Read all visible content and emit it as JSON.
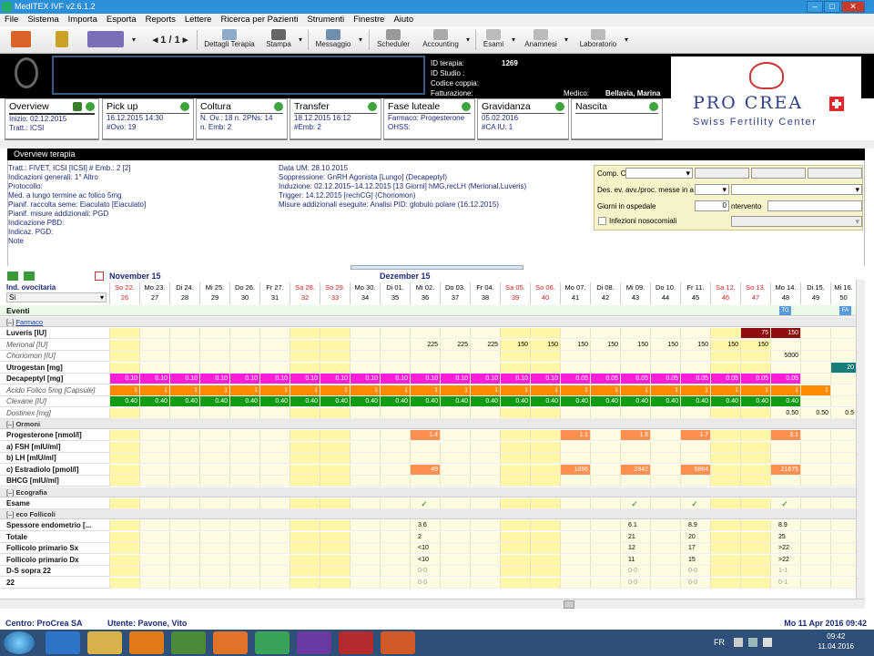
{
  "window": {
    "title": "MedITEX IVF v2.6.1.2",
    "min": "–",
    "max": "□",
    "close": "✕"
  },
  "menu": [
    "File",
    "Sistema",
    "Importa",
    "Esporta",
    "Reports",
    "Lettere",
    "Ricerca per Pazienti",
    "Strumenti",
    "Finestre",
    "Aiuto"
  ],
  "toolbar": {
    "pager": "1 / 1",
    "buttons": [
      "Dettagli Terapia",
      "Stampa",
      "Messaggio",
      "Scheduler",
      "Accounting",
      "Esami",
      "Anamnesi",
      "Laboratorio"
    ]
  },
  "header": {
    "id_terapia_label": "ID terapia:",
    "id_terapia_value": "1269",
    "id_studio_label": "ID Studio :",
    "codice_label": "Codice coppia:",
    "fatt_label": "Fatturazione:",
    "medico_label": "Medico:",
    "medico_value": "Bellavia, Marina"
  },
  "logo": {
    "big": "PRO CREA",
    "small": "Swiss Fertility Center"
  },
  "tabs": [
    {
      "title": "Overview",
      "lines": [
        "Inizio: 02.12.2015",
        "Tratt.: ICSI"
      ]
    },
    {
      "title": "Pick up",
      "lines": [
        "16.12.2015 14:30",
        "#Ovo: 19"
      ]
    },
    {
      "title": "Coltura",
      "lines": [
        "N. Ov.: 18 n. 2PNs: 14",
        "n. Emb: 2"
      ]
    },
    {
      "title": "Transfer",
      "lines": [
        "18.12.2015 16:12",
        "#Emb: 2"
      ]
    },
    {
      "title": "Fase luteale",
      "lines": [
        "Farmaco: Progesterone",
        "OHSS:"
      ]
    },
    {
      "title": "Gravidanza",
      "lines": [
        "05.02.2016",
        "#CA IU: 1"
      ]
    },
    {
      "title": "Nascita",
      "lines": [
        "",
        ""
      ]
    }
  ],
  "overview": {
    "bar": "Overview terapia",
    "left": [
      "Tratt.: FIVET, ICSI    [ICSI]    # Emb.: 2    [2]",
      "Indicazioni generali: 1° Altro",
      "Protocollo:",
      "Med. a lungo termine  ac folico 5mg",
      "Pianif. raccolta seme: Eiaculato    [Eiaculato]",
      "Pianif. misure addizionali: PGD",
      "Indicazione PBD:",
      "Indicaz. PGD:",
      "Note"
    ],
    "mid": [
      "Data UM: 28.10.2015",
      "Soppressione: GnRH Agonista [Lungo] (Decapeptyl)",
      "Induzione: 02.12.2015–14.12.2015 [13 Giorni] hMG,recLH (Merional,Luveris)",
      "Trigger: 14.12.2015 [rechCG] (Choriomon)",
      "Misure addizionali eseguite: Analisi PID: globulo polare (16.12.2015)"
    ],
    "right": {
      "comp": "Comp. C",
      "des": "Des. ev. avv./proc. messe in a",
      "giorni": "Giorni in ospedale",
      "giorni_val": "0",
      "intervento": "ntervento",
      "infezioni": "Infezioni nosocomiali"
    }
  },
  "grid": {
    "months": [
      "November 15",
      "Dezember 15"
    ],
    "ind_label": "Ind. ovocitaria",
    "ind_value": "Si",
    "eventi": "Eventi",
    "dates": [
      {
        "d": "So 22.",
        "n": "26",
        "red": true
      },
      {
        "d": "Mo 23.",
        "n": "27"
      },
      {
        "d": "Di 24.",
        "n": "28"
      },
      {
        "d": "Mi 25.",
        "n": "29"
      },
      {
        "d": "Do 26.",
        "n": "30"
      },
      {
        "d": "Fr 27.",
        "n": "31"
      },
      {
        "d": "Sa 28.",
        "n": "32",
        "red": true
      },
      {
        "d": "So 29.",
        "n": "33",
        "red": true
      },
      {
        "d": "Mo 30.",
        "n": "34"
      },
      {
        "d": "Di 01.",
        "n": "35"
      },
      {
        "d": "Mi 02.",
        "n": "36"
      },
      {
        "d": "Do 03.",
        "n": "37"
      },
      {
        "d": "Fr 04.",
        "n": "38"
      },
      {
        "d": "Sa 05.",
        "n": "39",
        "red": true
      },
      {
        "d": "So 06.",
        "n": "40",
        "red": true
      },
      {
        "d": "Mo 07.",
        "n": "41"
      },
      {
        "d": "Di 08.",
        "n": "42"
      },
      {
        "d": "Mi 09.",
        "n": "43"
      },
      {
        "d": "Do 10.",
        "n": "44"
      },
      {
        "d": "Fr 11.",
        "n": "45"
      },
      {
        "d": "Sa 12.",
        "n": "46",
        "red": true
      },
      {
        "d": "So 13.",
        "n": "47",
        "red": true
      },
      {
        "d": "Mo 14.",
        "n": "48"
      },
      {
        "d": "Di 15.",
        "n": "49"
      },
      {
        "d": "Mi 16.",
        "n": "50"
      }
    ],
    "sections": {
      "farmaco": "Farmaco",
      "ormoni": "Ormoni",
      "ecografia": "Ecografia",
      "follicoli": "eco Follicoli"
    },
    "rows": {
      "luveris": "Luveris [IU]",
      "merional": "Merional [IU]",
      "choriomon": "Choriomon [IU]",
      "utrogestan": "Utrogestan [mg]",
      "decapeptyl": "Decapeptyl [mg]",
      "acido": "Acido Folico 5mg [Capsule]",
      "clexane": "Clexane [IU]",
      "dostinex": "Dostinex [mg]",
      "progesterone": "Progesterone  [nmol/l]",
      "fsh": "a) FSH  [mIU/ml]",
      "lh": "b) LH  [mIU/ml]",
      "estradiolo": "c) Estradiolo  [pmol/l]",
      "bhcg": "BHCG  [mIU/ml]",
      "esame": "Esame",
      "spessore": "Spessore endometrio [...",
      "totale": "Totale",
      "fsx": "Follicolo primario Sx",
      "fdx": "Follicolo primario Dx",
      "ds": "D-S sopra 22",
      "n22": "22"
    },
    "values": {
      "luveris": {
        "21": "75",
        "22": "150"
      },
      "merional": {
        "10": "225",
        "11": "225",
        "12": "225",
        "13": "150",
        "14": "150",
        "15": "150",
        "16": "150",
        "17": "150",
        "18": "150",
        "19": "150",
        "20": "150",
        "21": "150"
      },
      "choriomon": {
        "22": "5000"
      },
      "utrogestan": {
        "24": "20"
      },
      "decapeptyl": {
        "0": "0.10",
        "1": "0.10",
        "2": "0.10",
        "3": "0.10",
        "4": "0.10",
        "5": "0.10",
        "6": "0.10",
        "7": "0.10",
        "8": "0.10",
        "9": "0.10",
        "10": "0.10",
        "11": "0.10",
        "12": "0.10",
        "13": "0.10",
        "14": "0.10",
        "15": "0.05",
        "16": "0.05",
        "17": "0.05",
        "18": "0.05",
        "19": "0.05",
        "20": "0.05",
        "21": "0.05",
        "22": "0.05"
      },
      "acido": {
        "0": "1",
        "1": "1",
        "2": "1",
        "3": "1",
        "4": "1",
        "5": "1",
        "6": "1",
        "7": "1",
        "8": "1",
        "9": "1",
        "10": "1",
        "11": "1",
        "12": "1",
        "13": "1",
        "14": "1",
        "15": "1",
        "16": "1",
        "17": "1",
        "18": "1",
        "19": "1",
        "20": "1",
        "21": "1",
        "22": "1",
        "23": "1"
      },
      "clexane": {
        "0": "0.40",
        "1": "0.40",
        "2": "0.40",
        "3": "0.40",
        "4": "0.40",
        "5": "0.40",
        "6": "0.40",
        "7": "0.40",
        "8": "0.40",
        "9": "0.40",
        "10": "0.40",
        "11": "0.40",
        "12": "0.40",
        "13": "0.40",
        "14": "0.40",
        "15": "0.40",
        "16": "0.40",
        "17": "0.40",
        "18": "0.40",
        "19": "0.40",
        "20": "0.40",
        "21": "0.40",
        "22": "0.40"
      },
      "dostinex": {
        "22": "0.50",
        "23": "0.50",
        "24": "0.5"
      },
      "progesterone": {
        "10": "1.4",
        "15": "1.1",
        "17": "1.6",
        "19": "1.7",
        "22": "3.1"
      },
      "estradiolo": {
        "10": "49",
        "15": "1056",
        "17": "2842",
        "19": "5864",
        "22": "21675"
      },
      "esame": {
        "10": "✓",
        "17": "✓",
        "19": "✓",
        "22": "✓"
      },
      "spessore": {
        "10": "3.6",
        "17": "6.1",
        "19": "8.9",
        "22": "8.9"
      },
      "totale": {
        "10": "2",
        "17": "21",
        "19": "20",
        "22": "25"
      },
      "fsx": {
        "10": "<10",
        "17": "12",
        "19": "17",
        "22": ">22"
      },
      "fdx": {
        "10": "<10",
        "17": "11",
        "19": "15",
        "22": ">22"
      },
      "ds": {
        "10": "0-0",
        "17": "0-0",
        "19": "0-0",
        "22": "1-1"
      },
      "n22": {
        "10": "0-0",
        "17": "0-0",
        "19": "0-0",
        "22": "0-1"
      }
    },
    "badges": {
      "tg": "TG",
      "fa": "FA"
    }
  },
  "status": {
    "centro": "Centro: ProCrea SA",
    "utente": "Utente: Pavone, Vito",
    "data": "Mo 11 Apr 2016 09:42"
  },
  "taskbar": {
    "lang": "FR",
    "time": "09:42",
    "date": "11.04.2016"
  },
  "colors": {
    "titlebar": "#2c8fd9",
    "decapeptyl": "#ff1ed8",
    "acido": "#ff8a00",
    "clexane": "#129b12",
    "hormone": "#ff8f4f",
    "weekend": "#fff6a6",
    "luveris": "#8f0d0d",
    "utrogestan": "#167d78"
  }
}
